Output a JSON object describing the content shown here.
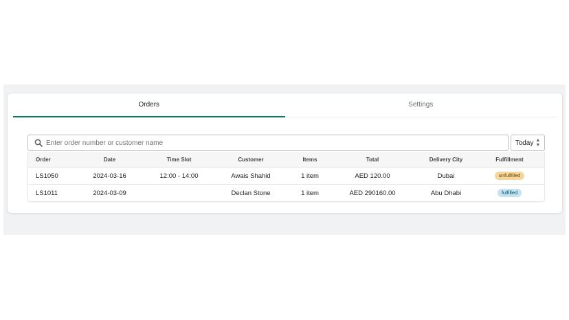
{
  "tabs": [
    {
      "label": "Orders",
      "active": true
    },
    {
      "label": "Settings",
      "active": false
    }
  ],
  "search": {
    "placeholder": "Enter order number or customer name",
    "value": "",
    "icon": "search-icon"
  },
  "date_filter": {
    "selected": "Today",
    "icon": "sort-icon"
  },
  "table": {
    "columns": [
      "Order",
      "Date",
      "Time Slot",
      "Customer",
      "Items",
      "Total",
      "Delivery City",
      "Fulfillment"
    ],
    "rows": [
      {
        "order": "LS1050",
        "date": "2024-03-16",
        "time_slot": "12:00 - 14:00",
        "customer": "Awais Shahid",
        "items": "1 item",
        "total": "AED 120.00",
        "city": "Dubai",
        "fulfillment": "unfulfilled"
      },
      {
        "order": "LS1011",
        "date": "2024-03-09",
        "time_slot": "",
        "customer": "Declan Stone",
        "items": "1 item",
        "total": "AED 290160.00",
        "city": "Abu Dhabi",
        "fulfillment": "fulfilled"
      }
    ]
  },
  "colors": {
    "accent": "#008060",
    "unfulfilled_badge": "#f6d69a",
    "fulfilled_badge": "#c6e3f2",
    "background": "#f1f2f3"
  }
}
